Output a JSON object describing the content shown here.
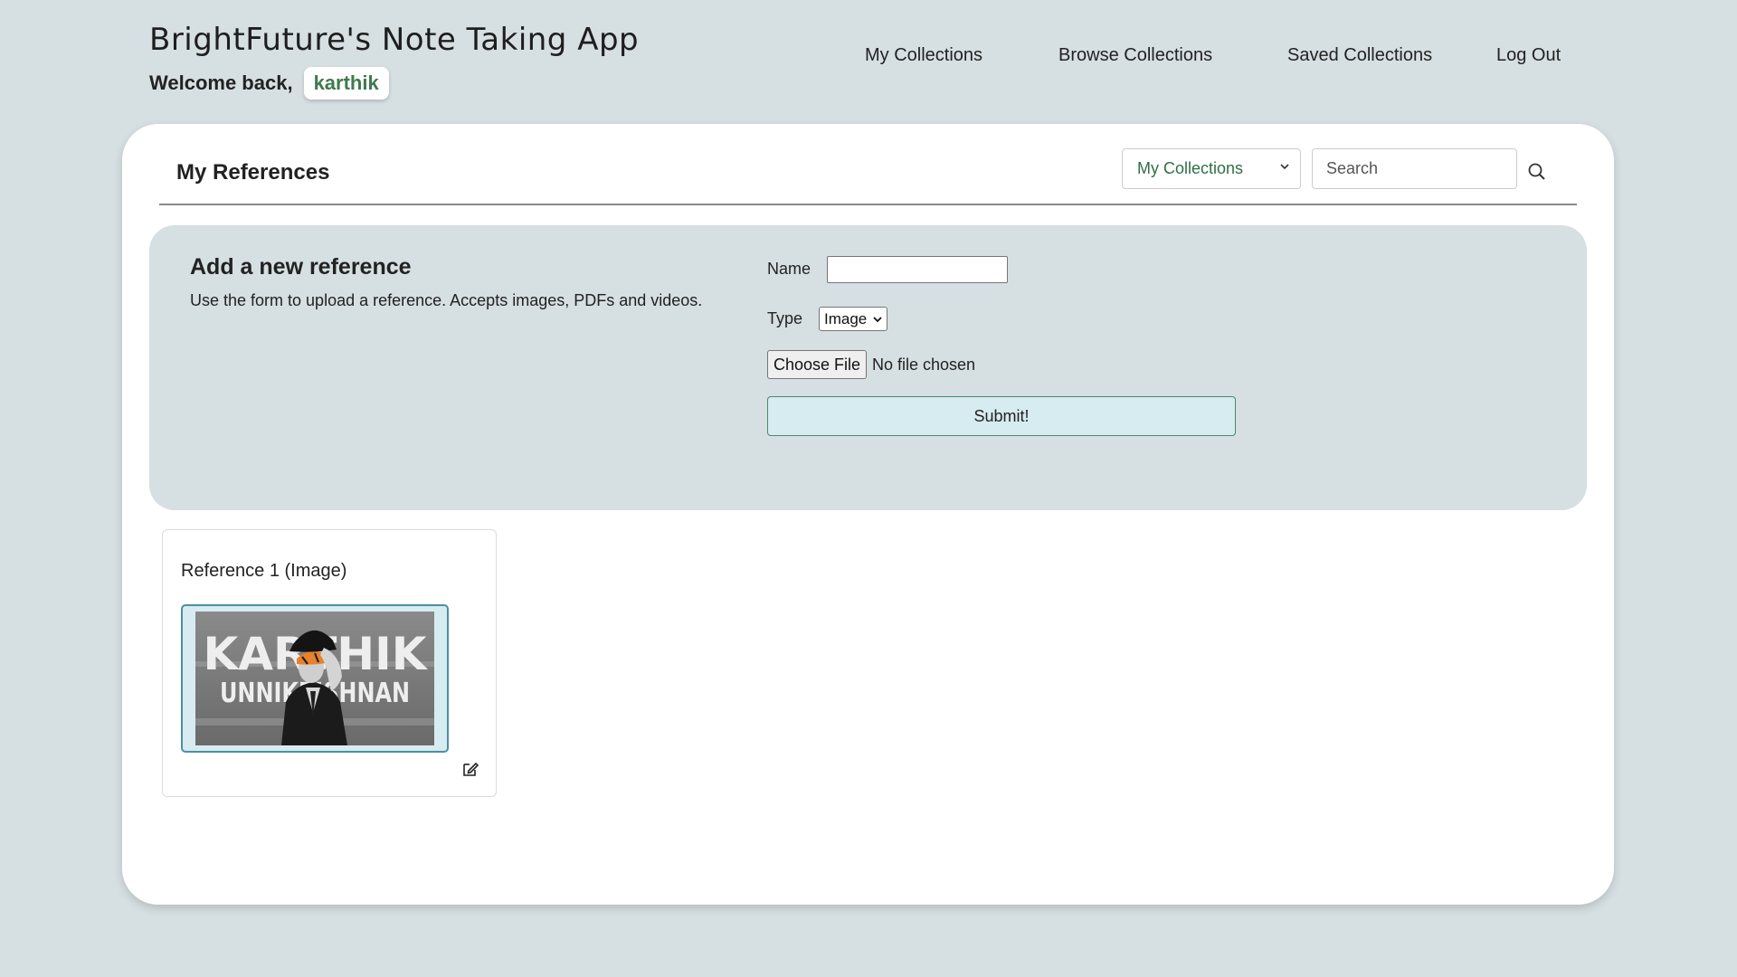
{
  "header": {
    "app_title": "BrightFuture's Note Taking App",
    "welcome_text": "Welcome back,",
    "username": "karthik"
  },
  "nav": {
    "items": [
      "My Collections",
      "Browse Collections",
      "Saved Collections",
      "Log Out"
    ]
  },
  "main": {
    "title": "My References",
    "collection_filter": "My Collections",
    "search_placeholder": "Search"
  },
  "upload": {
    "title": "Add a new reference",
    "description": "Use the form to upload a reference. Accepts images, PDFs and videos.",
    "name_label": "Name",
    "name_value": "",
    "type_label": "Type",
    "type_value": "Image",
    "choose_file_label": "Choose File",
    "file_status": "No file chosen",
    "submit_label": "Submit!"
  },
  "references": [
    {
      "title": "Reference 1 (Image)",
      "thumbnail_text_line1": "KARTHIK",
      "thumbnail_text_line2": "UNNIKRISHNAN"
    }
  ],
  "icons": {
    "search": "search-icon",
    "edit": "edit-icon",
    "dropdown": "chevron-down-icon"
  },
  "colors": {
    "page_bg": "#d6dfe2",
    "card_bg": "#ffffff",
    "accent_green": "#3f7a4e",
    "submit_bg": "#d7ecf0"
  }
}
